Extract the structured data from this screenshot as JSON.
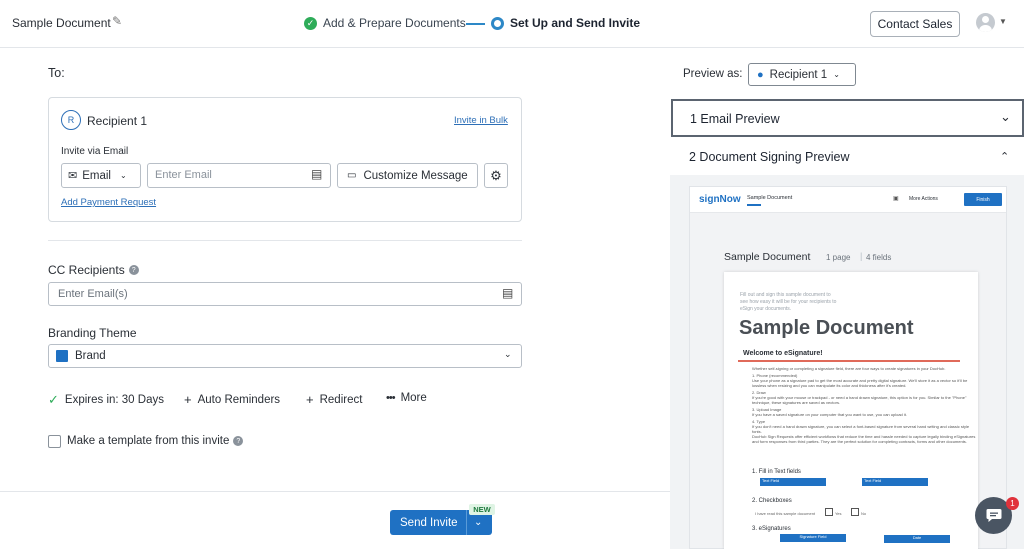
{
  "header": {
    "doc_title": "Sample Document",
    "step1": "Add & Prepare Documents",
    "step2": "Set Up and Send Invite",
    "contact_sales": "Contact Sales"
  },
  "to_label": "To:",
  "recipient": {
    "initial": "R",
    "name": "Recipient 1",
    "invite_bulk": "Invite in Bulk",
    "invite_via": "Invite via Email",
    "method": "Email",
    "email_placeholder": "Enter Email",
    "customize": "Customize Message",
    "add_payment": "Add Payment Request"
  },
  "cc": {
    "label": "CC Recipients",
    "placeholder": "Enter Email(s)"
  },
  "branding": {
    "label": "Branding Theme",
    "value": "Brand",
    "color": "#1f71c3"
  },
  "options": {
    "expires": "Expires in: 30 Days",
    "reminders": "Auto Reminders",
    "redirect": "Redirect",
    "more": "More"
  },
  "template_label": "Make a template from this invite",
  "footer": {
    "send": "Send Invite",
    "new_badge": "NEW"
  },
  "preview": {
    "label": "Preview as:",
    "recipient": "Recipient 1",
    "email_preview": "1  Email Preview",
    "doc_preview": "2  Document Signing Preview",
    "brand": "signNow",
    "doc_tab": "Sample Document",
    "more_actions": "More Actions",
    "finish": "Finish",
    "doc_name": "Sample Document",
    "pages": "1 page",
    "fields": "4 fields",
    "paper": {
      "intro1": "Fill out and sign this sample document to",
      "intro2": "see how easy it will be for your recipients to",
      "intro3": "eSign your documents.",
      "heading": "Sample Document",
      "welcome": "Welcome to eSignature!",
      "p1": "Whether self-signing or completing a signature field, there are four ways to create signatures in your DocHub.",
      "s1": "1.  Phone (recommended)",
      "s1t": "Use your phone as a signature pad to get the most accurate and pretty digital signature. We'll store it as a vector so it'll be lossless when resizing and you can manipulate its color and thickness after it's created.",
      "s2": "2.  Draw",
      "s2t": "If you're good with your mouse or trackpad - or need a hand drawn signature, this option is for you. Similar to the \"Phone\" technique, these signatures are saved as vectors.",
      "s3": "3.  Upload Image",
      "s3t": "If you have a saved signature on your computer that you want to use, you can upload it.",
      "s4": "4.  Type",
      "s4t": "If you don't need a hand drawn signature, you can select a font-based signature from several hand writing and classic style fonts.",
      "s5t": "DocHub Sign Requests offer efficient workflows that reduce the time and hassle needed to capture legally binding eSignatures and form responses from third parties. They are the perfect solution for completing contracts, forms and other documents.",
      "f1": "1. Fill in Text fields",
      "text_field": "Text Field",
      "f2": "2. Checkboxes",
      "cb_text": "I have read this sample document",
      "yes": "Yes",
      "no": "No",
      "f3": "3. eSignatures",
      "sig_field": "Signature Field",
      "date": "Date"
    },
    "chat_badge": "1"
  }
}
